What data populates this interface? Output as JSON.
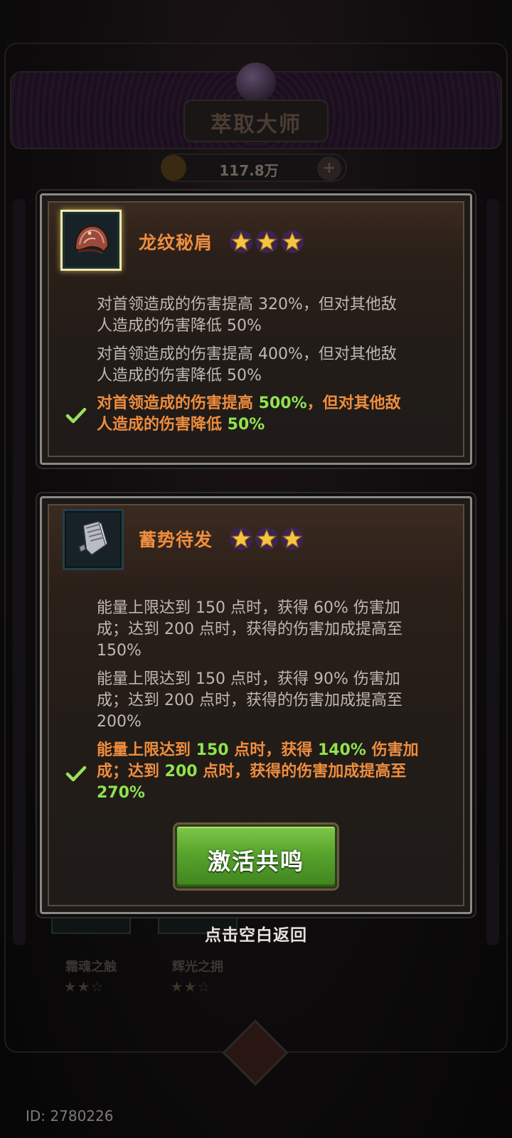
{
  "background": {
    "title": "萃取大师",
    "currency_amount": "117.8万",
    "items": [
      {
        "name": "霜魂之触",
        "stars": "★★☆"
      },
      {
        "name": "辉光之拥",
        "stars": "★★☆"
      }
    ],
    "id_label": "ID: 2780226"
  },
  "cards": [
    {
      "name": "龙纹秘肩",
      "icon": "shoulder-armor-icon",
      "stars": 3,
      "options": [
        {
          "line1": "对首领造成的伤害提高 320%，但对其他敌",
          "line2": "人造成的伤害降低 50%",
          "active": false
        },
        {
          "line1": "对首领造成的伤害提高 400%，但对其他敌",
          "line2": "人造成的伤害降低 50%",
          "active": false
        },
        {
          "a": "对首领造成的伤害提高 ",
          "b": "500%",
          "c": "，但对其他敌",
          "d": "人造成的伤害降低 ",
          "e": "50%",
          "active": true
        }
      ]
    },
    {
      "name": "蓄势待发",
      "icon": "gauntlet-icon",
      "stars": 3,
      "options": [
        {
          "line1": "能量上限达到 150 点时，获得 60% 伤害加",
          "line2": "成；达到 200 点时，获得的伤害加成提高至",
          "line3": "150%",
          "active": false
        },
        {
          "line1": "能量上限达到 150 点时，获得 90% 伤害加",
          "line2": "成；达到 200 点时，获得的伤害加成提高至",
          "line3": "200%",
          "active": false
        },
        {
          "a": "能量上限达到 ",
          "b": "150",
          "c": " 点时，获得 ",
          "d": "140%",
          "e": " 伤害加",
          "f": "成；达到 ",
          "g": "200",
          "h": " 点时，获得的伤害加成提高至",
          "i": "270%",
          "active": true
        }
      ]
    }
  ],
  "activate_button": "激活共鸣",
  "tap_to_return": "点击空白返回",
  "colors": {
    "title_orange": "#ef8d3e",
    "highlight_green": "#8fe34f",
    "text_gray": "#bfb9b1",
    "button_green": "#58a42d"
  }
}
